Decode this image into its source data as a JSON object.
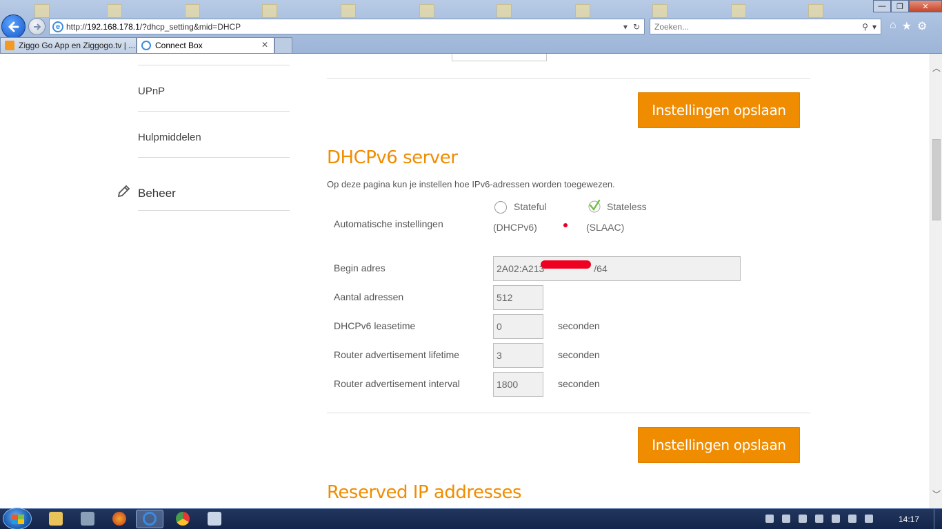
{
  "browser": {
    "url_prefix": "http://",
    "url_host": "192.168.178.1",
    "url_path": "/?dhcp_setting&mid=DHCP",
    "search_placeholder": "Zoeken...",
    "tabs": [
      {
        "label": "Ziggo Go App en Ziggogo.tv | ...",
        "active": false
      },
      {
        "label": "Connect Box",
        "active": true
      }
    ],
    "tab_close_glyph": "✕",
    "window_controls": {
      "minimize": "—",
      "maximize": "❐",
      "close": "✕"
    }
  },
  "sidebar": {
    "items": [
      {
        "label": "UPnP"
      },
      {
        "label": "Hulpmiddelen"
      }
    ],
    "beheer_label": "Beheer",
    "beheer_icon": "pencil-icon"
  },
  "main": {
    "save_label": "Instellingen opslaan",
    "dhcpv6_title": "DHCPv6 server",
    "dhcpv6_description": "Op deze pagina kun je instellen hoe IPv6-adressen worden toegewezen.",
    "auto_settings_label": "Automatische instellingen",
    "options": {
      "stateful": {
        "label": "Stateful",
        "sub": "(DHCPv6)",
        "selected": false
      },
      "stateless": {
        "label": "Stateless",
        "sub": "(SLAAC)",
        "selected": true
      }
    },
    "fields": {
      "begin_adres": {
        "label": "Begin adres",
        "value_start": "2A02:A213",
        "value_end": "/64"
      },
      "aantal_adressen": {
        "label": "Aantal adressen",
        "value": "512"
      },
      "leasetime": {
        "label": "DHCPv6 leasetime",
        "value": "0",
        "unit": "seconden"
      },
      "ra_lifetime": {
        "label": "Router advertisement lifetime",
        "value": "3",
        "unit": "seconden"
      },
      "ra_interval": {
        "label": "Router advertisement interval",
        "value": "1800",
        "unit": "seconden"
      }
    },
    "reserved_title": "Reserved IP addresses"
  },
  "taskbar": {
    "clock": "14:17"
  },
  "colors": {
    "accent": "#f08c00",
    "title": "#f08c00",
    "redaction": "#f00020"
  }
}
